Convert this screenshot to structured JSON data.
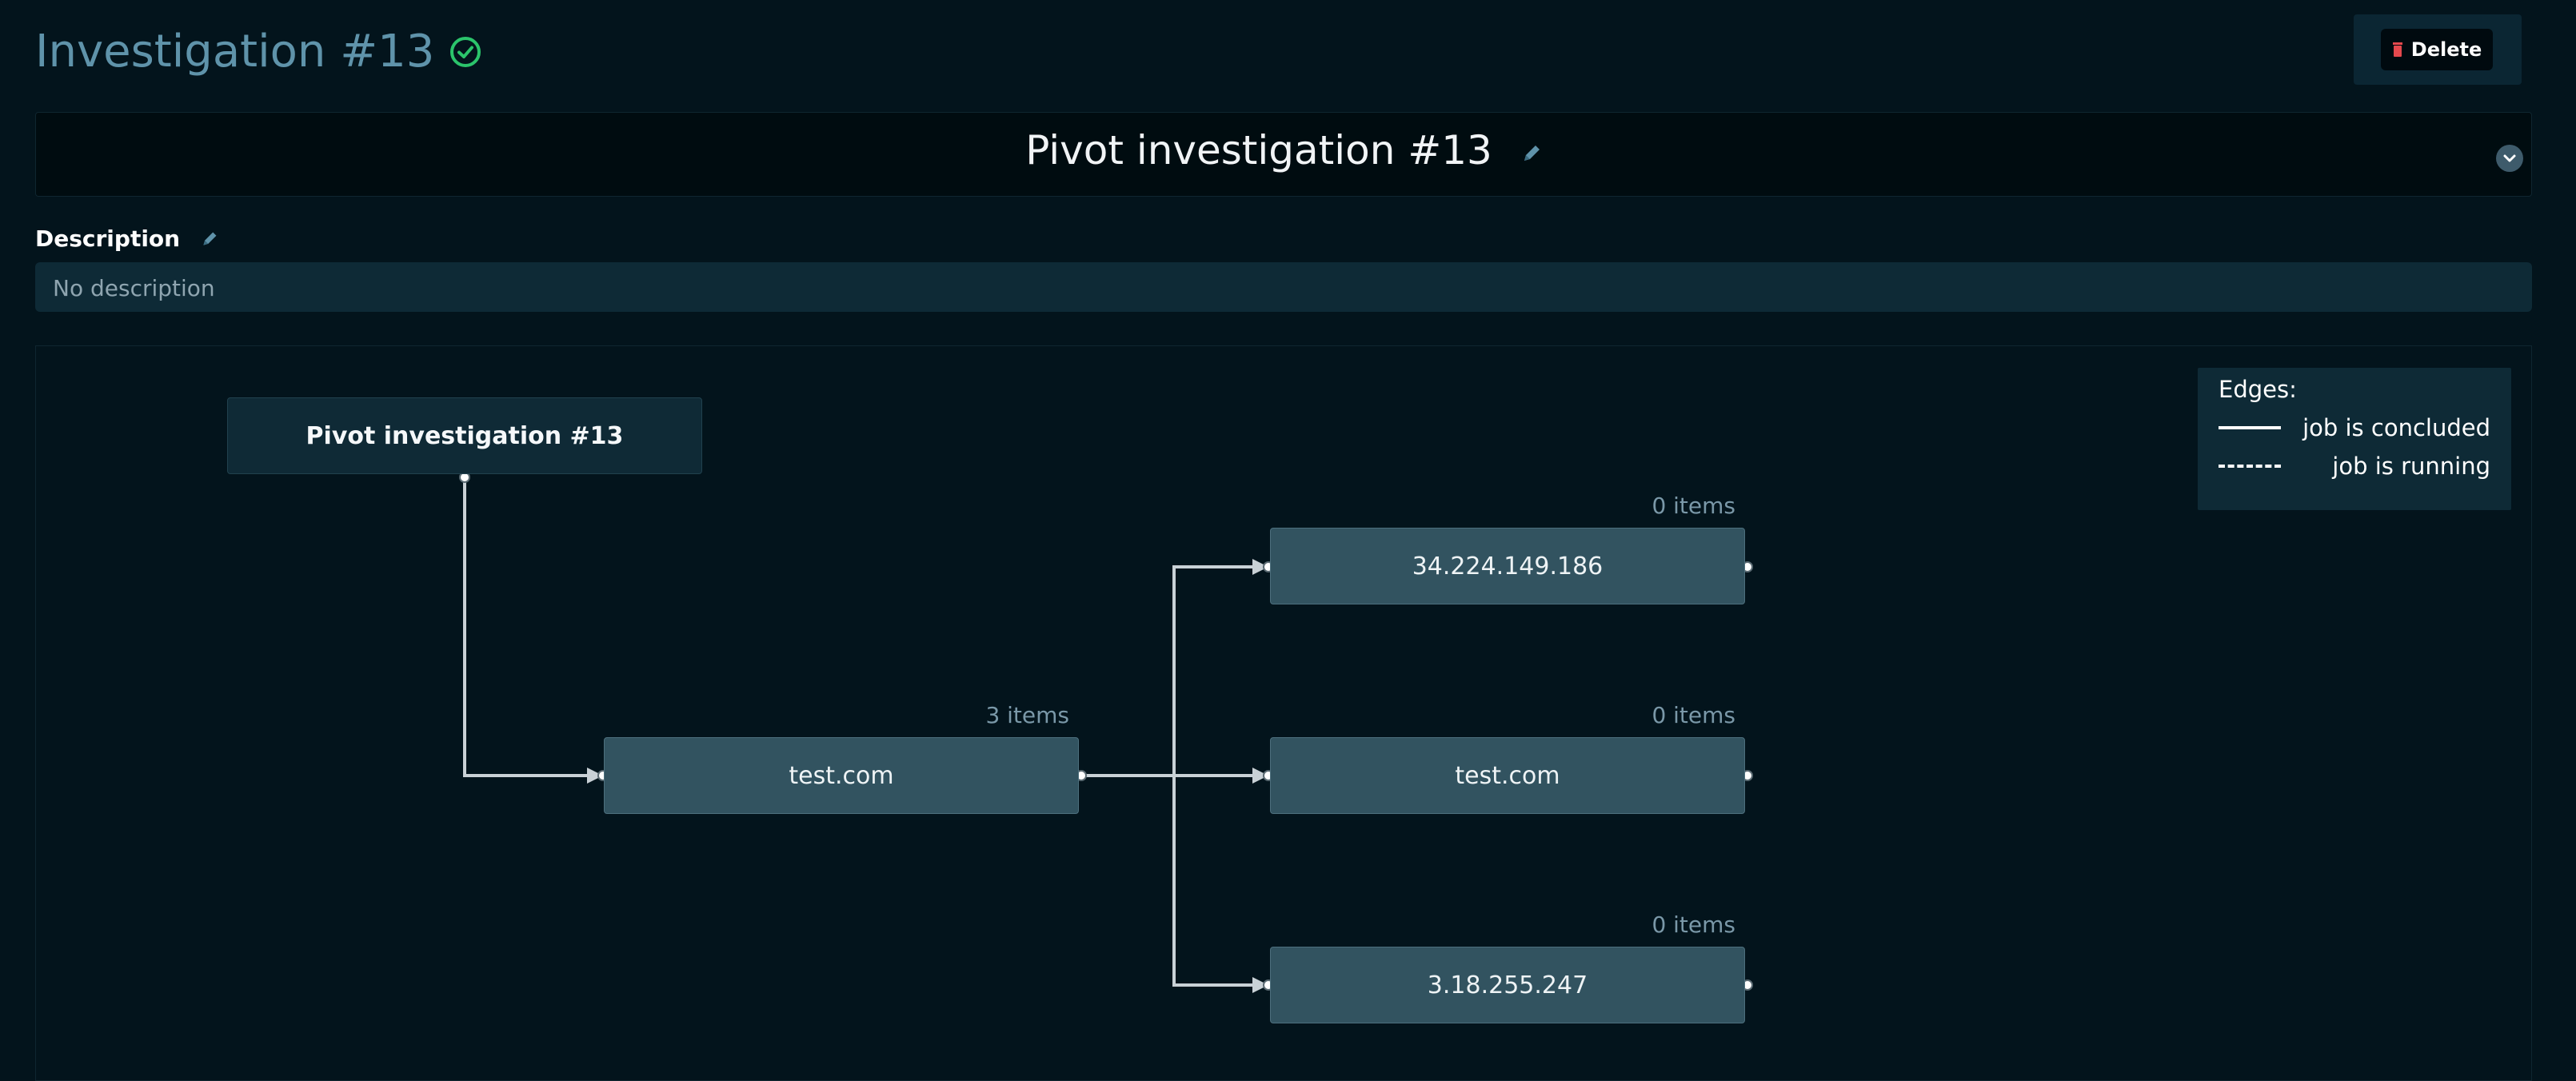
{
  "header": {
    "title": "Investigation #13",
    "status_icon": "check-circle-icon",
    "status_color": "#2bc46b"
  },
  "actions": {
    "delete_label": "Delete",
    "delete_icon": "trash-icon",
    "delete_icon_color": "#e5484d"
  },
  "investigation": {
    "name": "Pivot investigation #13"
  },
  "description": {
    "label": "Description",
    "value": "No description"
  },
  "graph": {
    "nodes": [
      {
        "id": "root",
        "label": "Pivot investigation #13"
      },
      {
        "id": "n1",
        "label": "test.com",
        "count": "3 items"
      },
      {
        "id": "n2",
        "label": "34.224.149.186",
        "count": "0 items"
      },
      {
        "id": "n3",
        "label": "test.com",
        "count": "0 items"
      },
      {
        "id": "n4",
        "label": "3.18.255.247",
        "count": "0 items"
      }
    ],
    "edges": [
      {
        "from": "root",
        "to": "n1",
        "status": "concluded"
      },
      {
        "from": "n1",
        "to": "n2",
        "status": "concluded"
      },
      {
        "from": "n1",
        "to": "n3",
        "status": "concluded"
      },
      {
        "from": "n1",
        "to": "n4",
        "status": "concluded"
      }
    ]
  },
  "legend": {
    "title": "Edges:",
    "concluded": "job is concluded",
    "running": "job is running"
  },
  "colors": {
    "background": "#03141c",
    "accent": "#5f93aa",
    "node_fill": "#325360",
    "edge": "#c9d1d6"
  }
}
